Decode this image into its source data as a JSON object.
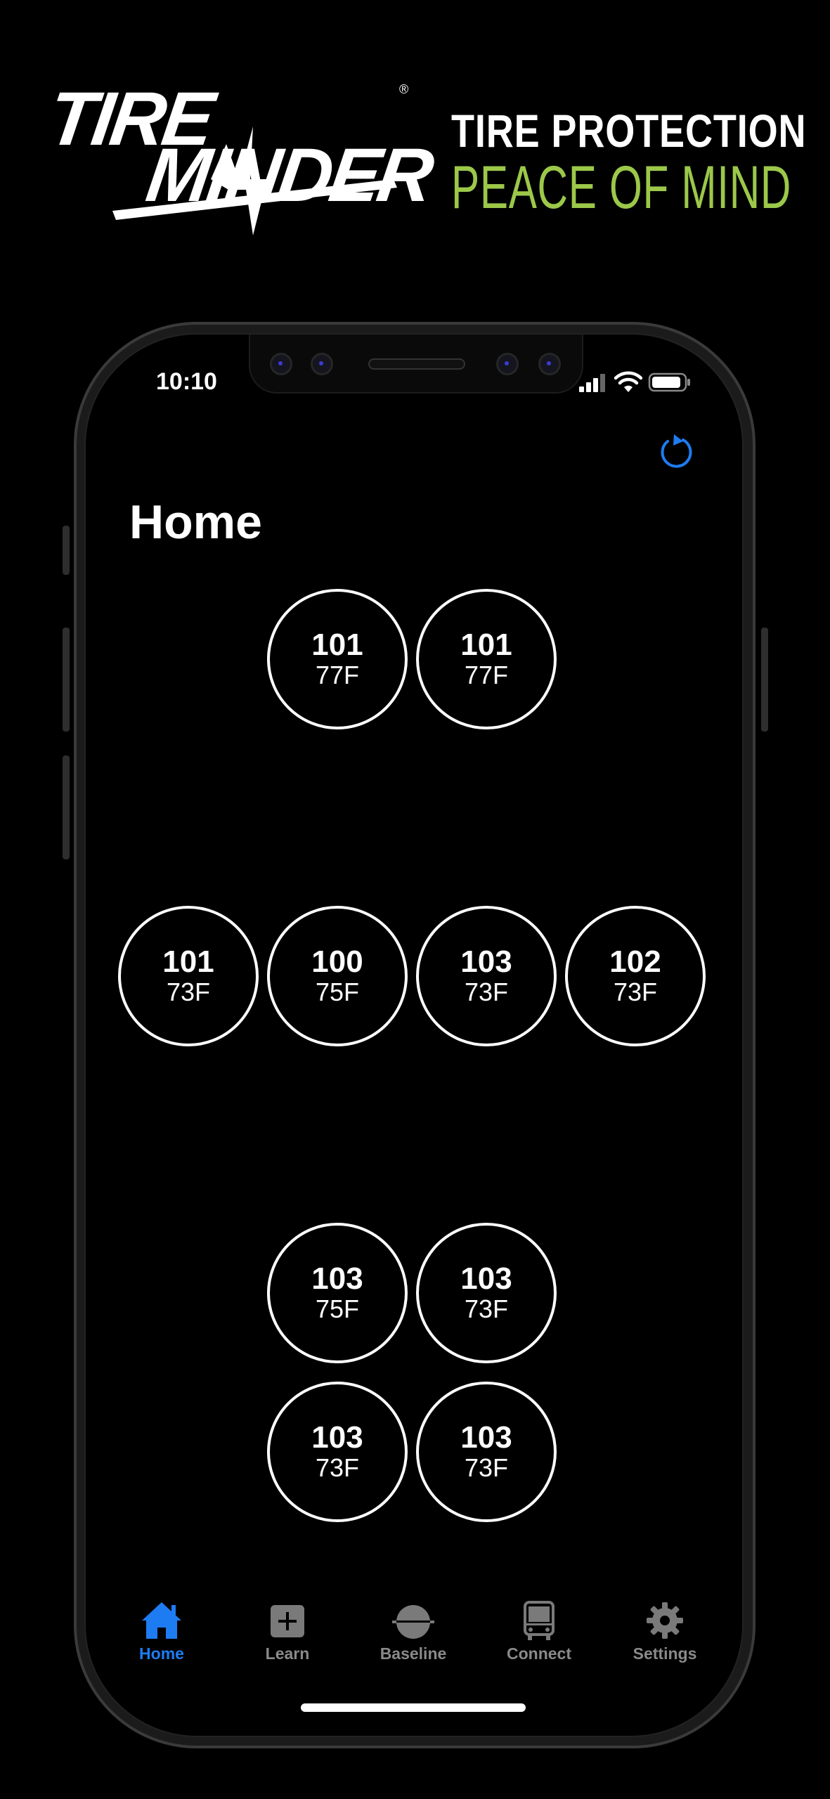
{
  "branding": {
    "logo_line1": "TIRE",
    "logo_line2": "MINDER",
    "logo_reg": "®",
    "tagline_primary": "TIRE PROTECTION",
    "tagline_secondary": "PEACE OF MIND",
    "accent_color": "#9cc84a"
  },
  "status_bar": {
    "time": "10:10",
    "icons": [
      "cellular-signal-icon",
      "wifi-icon",
      "battery-icon"
    ]
  },
  "header": {
    "title": "Home",
    "refresh_icon": "refresh-icon",
    "refresh_color": "#1e7cf2"
  },
  "axles": [
    {
      "tires": [
        {
          "psi": "101",
          "temp": "77F"
        },
        {
          "psi": "101",
          "temp": "77F"
        }
      ]
    },
    {
      "tires": [
        {
          "psi": "101",
          "temp": "73F"
        },
        {
          "psi": "100",
          "temp": "75F"
        },
        {
          "psi": "103",
          "temp": "73F"
        },
        {
          "psi": "102",
          "temp": "73F"
        }
      ]
    },
    {
      "tires": [
        {
          "psi": "103",
          "temp": "75F"
        },
        {
          "psi": "103",
          "temp": "73F"
        }
      ]
    },
    {
      "tires": [
        {
          "psi": "103",
          "temp": "73F"
        },
        {
          "psi": "103",
          "temp": "73F"
        }
      ]
    }
  ],
  "tabbar": {
    "active_color": "#1e7cf2",
    "inactive_color": "#8a8a8a",
    "items": [
      {
        "label": "Home",
        "icon": "house-icon",
        "active": true
      },
      {
        "label": "Learn",
        "icon": "plus-square-icon",
        "active": false
      },
      {
        "label": "Baseline",
        "icon": "baseline-gauge-icon",
        "active": false
      },
      {
        "label": "Connect",
        "icon": "bus-icon",
        "active": false
      },
      {
        "label": "Settings",
        "icon": "gear-icon",
        "active": false
      }
    ]
  }
}
